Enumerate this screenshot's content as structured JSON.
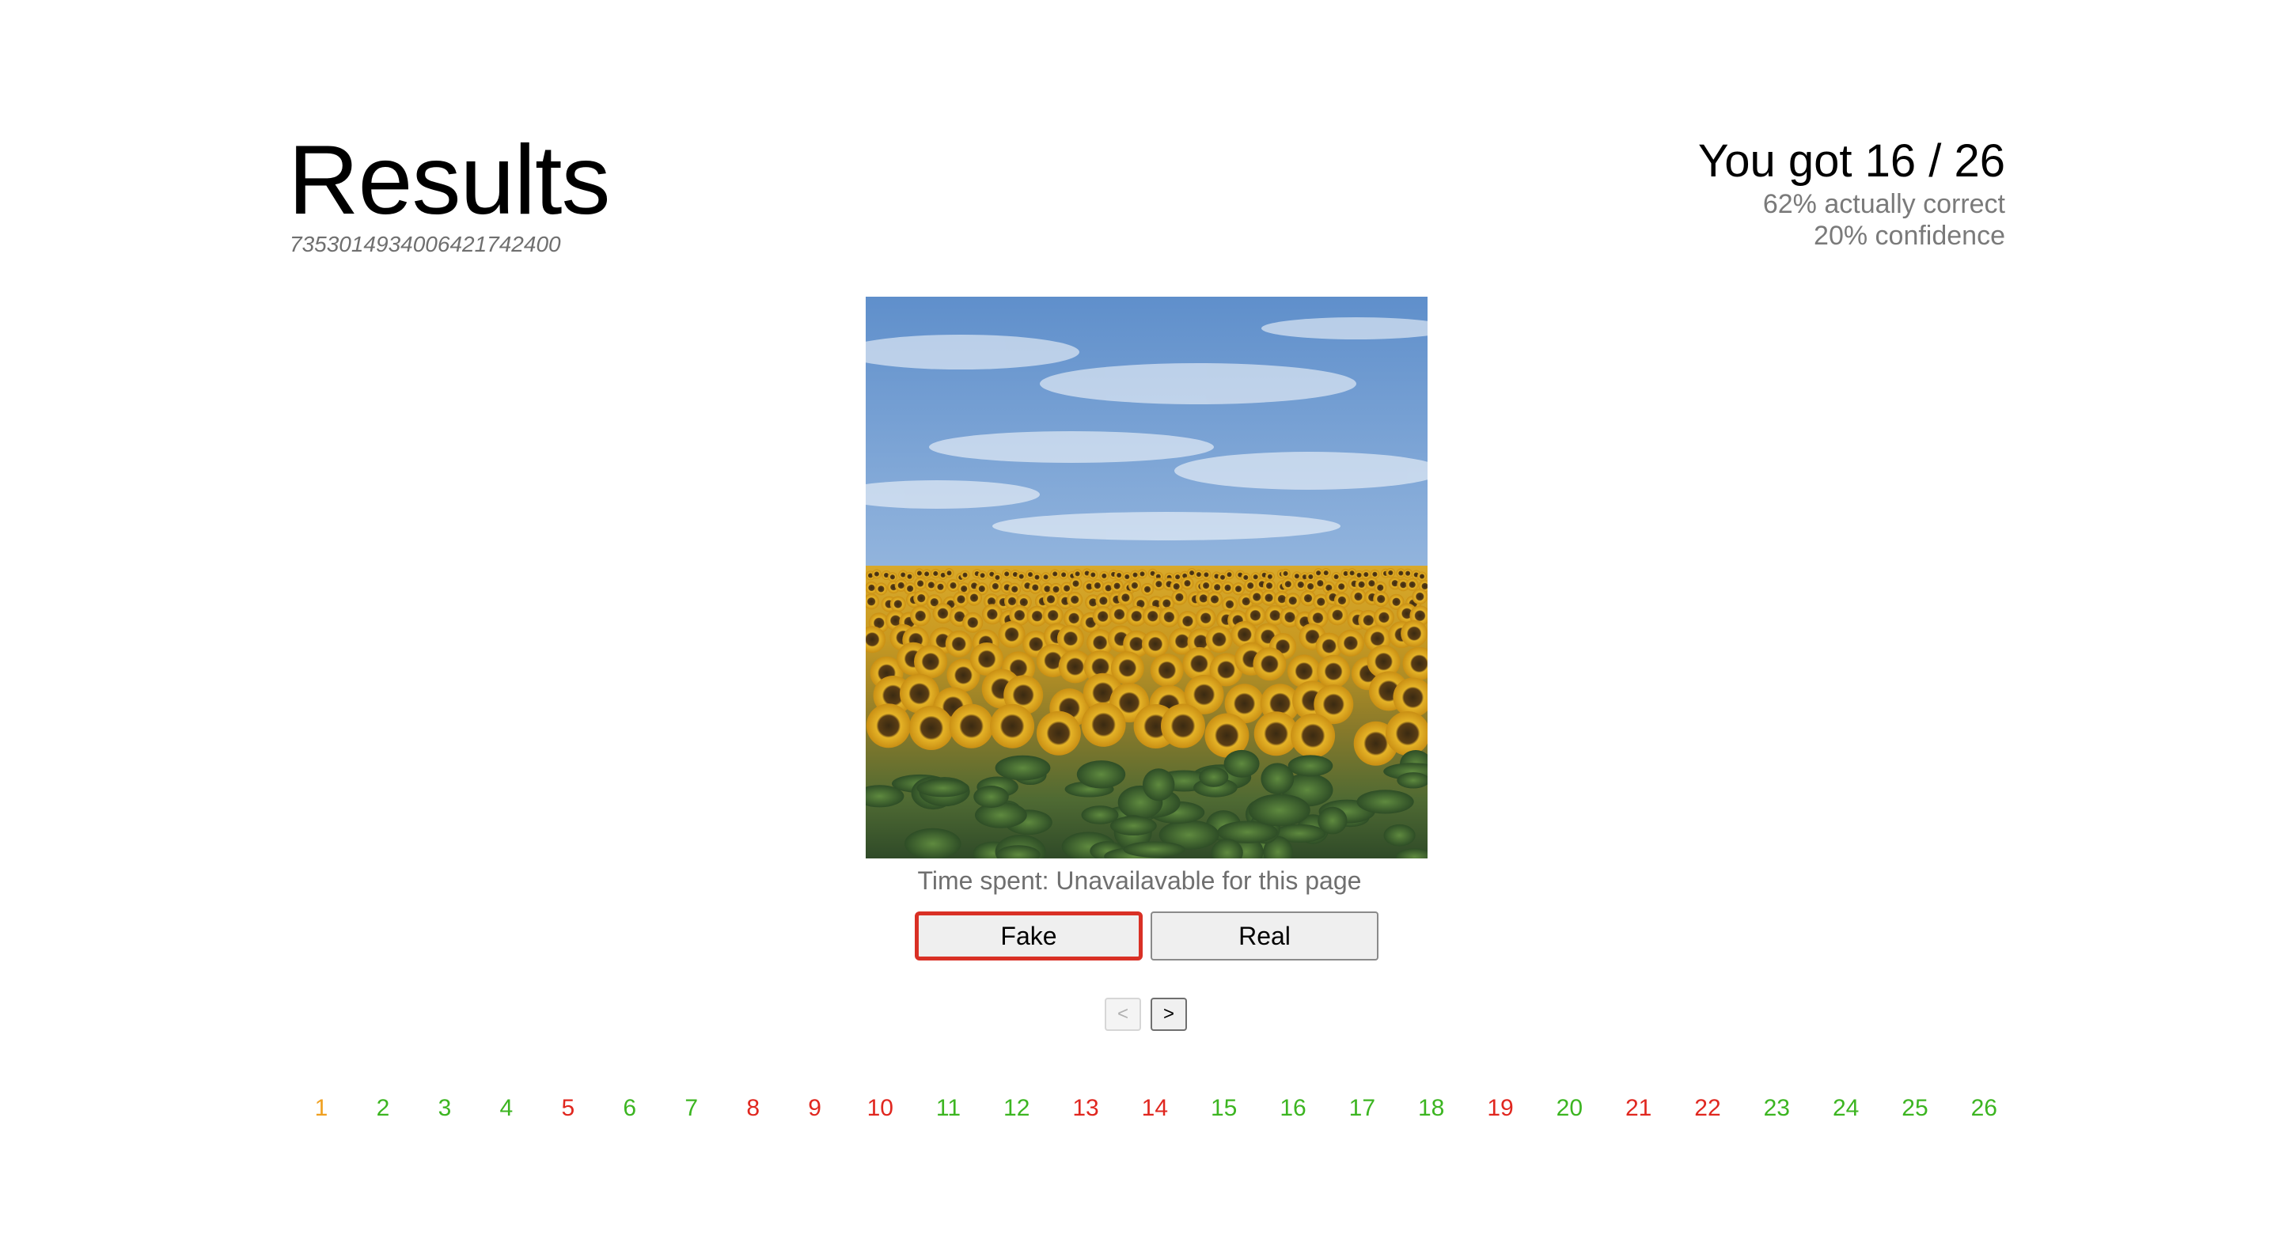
{
  "header": {
    "title": "Results",
    "session_id": "7353014934006421742400"
  },
  "score": {
    "main": "You got 16 / 26",
    "accuracy": "62% actually correct",
    "confidence": "20% confidence"
  },
  "image": {
    "description_icon": "sunflower-field-photo"
  },
  "time_spent": "Time spent: Unavailavable for this page",
  "answers": {
    "fake_label": "Fake",
    "real_label": "Real",
    "selected": "Fake"
  },
  "pager": {
    "prev_label": "<",
    "next_label": ">"
  },
  "colors": {
    "correct": "#3cb521",
    "incorrect": "#e0271f",
    "current": "#f0a020",
    "selected_border": "#d93025"
  },
  "pages": [
    {
      "label": "1",
      "status": "current"
    },
    {
      "label": "2",
      "status": "correct"
    },
    {
      "label": "3",
      "status": "correct"
    },
    {
      "label": "4",
      "status": "correct"
    },
    {
      "label": "5",
      "status": "incorrect"
    },
    {
      "label": "6",
      "status": "correct"
    },
    {
      "label": "7",
      "status": "correct"
    },
    {
      "label": "8",
      "status": "incorrect"
    },
    {
      "label": "9",
      "status": "incorrect"
    },
    {
      "label": "10",
      "status": "incorrect"
    },
    {
      "label": "11",
      "status": "correct"
    },
    {
      "label": "12",
      "status": "correct"
    },
    {
      "label": "13",
      "status": "incorrect"
    },
    {
      "label": "14",
      "status": "incorrect"
    },
    {
      "label": "15",
      "status": "correct"
    },
    {
      "label": "16",
      "status": "correct"
    },
    {
      "label": "17",
      "status": "correct"
    },
    {
      "label": "18",
      "status": "correct"
    },
    {
      "label": "19",
      "status": "incorrect"
    },
    {
      "label": "20",
      "status": "correct"
    },
    {
      "label": "21",
      "status": "incorrect"
    },
    {
      "label": "22",
      "status": "incorrect"
    },
    {
      "label": "23",
      "status": "correct"
    },
    {
      "label": "24",
      "status": "correct"
    },
    {
      "label": "25",
      "status": "correct"
    },
    {
      "label": "26",
      "status": "correct"
    }
  ]
}
